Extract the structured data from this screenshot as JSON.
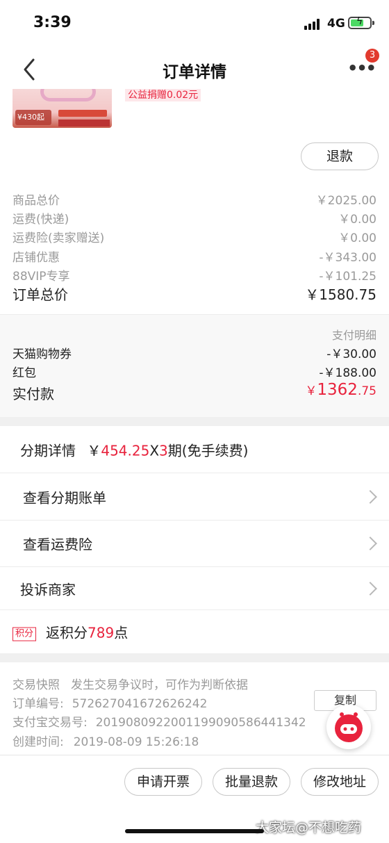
{
  "status_bar": {
    "time": "3:39",
    "network": "4G"
  },
  "nav": {
    "title": "订单详情",
    "more_icon": "more-icon",
    "badge_count": "3"
  },
  "product": {
    "price_tag": "¥430起",
    "charity_text": "公益捐赠0.02元"
  },
  "refund_button": "退款",
  "summary": [
    {
      "label": "商品总价",
      "value": "￥2025.00"
    },
    {
      "label": "运费(快递)",
      "value": "￥0.00"
    },
    {
      "label": "运费险(卖家赠送)",
      "value": "￥0.00"
    },
    {
      "label": "店铺优惠",
      "value": "-￥343.00"
    },
    {
      "label": "88VIP专享",
      "value": "-￥101.25"
    }
  ],
  "order_total": {
    "label": "订单总价",
    "value": "￥1580.75"
  },
  "payment": {
    "detail_link": "支付明细",
    "items": [
      {
        "label": "天猫购物券",
        "value": "-￥30.00"
      },
      {
        "label": "红包",
        "value": "-￥188.00"
      }
    ],
    "paid_label": "实付款",
    "paid_currency": "￥",
    "paid_int": "1362",
    "paid_dec": ".75"
  },
  "installment": {
    "label": "分期详情",
    "currency": "￥",
    "amount": "454.25",
    "times_x": "X",
    "periods": "3",
    "suffix": "期(免手续费)"
  },
  "menu": [
    {
      "label": "查看分期账单"
    },
    {
      "label": "查看运费险"
    },
    {
      "label": "投诉商家"
    }
  ],
  "points": {
    "tag": "积分",
    "prefix": "返积分",
    "value": "789",
    "suffix": "点"
  },
  "trade_info": {
    "snapshot": "交易快照",
    "snapshot_note": "发生交易争议时，可作为判断依据",
    "order_no_label": "订单编号:",
    "order_no": "572627041672626242",
    "alipay_label": "支付宝交易号:",
    "alipay_no": "2019080922001199090586441342",
    "created_label": "创建时间:",
    "created": "2019-08-09 15:26:18",
    "copy_label": "复制"
  },
  "bottom_actions": [
    "申请开票",
    "批量退款",
    "修改地址"
  ],
  "watermark": "大家坛@不想吃药",
  "colors": {
    "accent": "#e8233d",
    "muted": "#9a9a9a",
    "badge": "#e23a2e"
  }
}
